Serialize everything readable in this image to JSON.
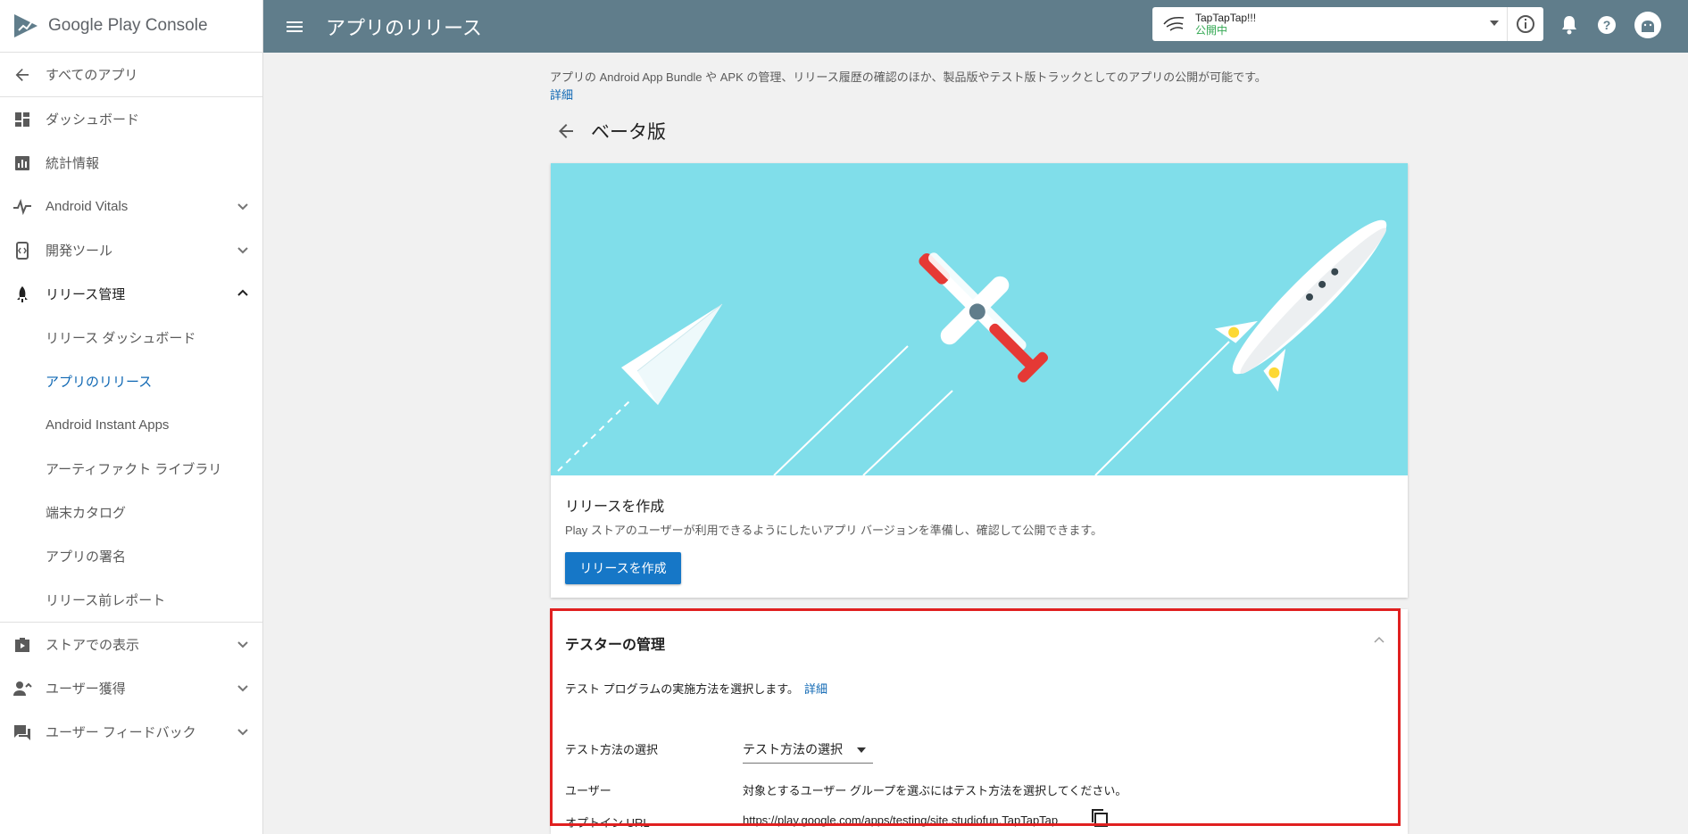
{
  "brand": {
    "name_google": "Google",
    "name_console": "Play Console"
  },
  "sidebar": {
    "back_label": "すべてのアプリ",
    "items": [
      {
        "label": "ダッシュボード",
        "icon": "dashboard-icon"
      },
      {
        "label": "統計情報",
        "icon": "stats-icon"
      },
      {
        "label": "Android Vitals",
        "icon": "vitals-icon"
      },
      {
        "label": "開発ツール",
        "icon": "dev-tools-icon"
      },
      {
        "label": "リリース管理",
        "icon": "rocket-icon"
      }
    ],
    "sub_items": [
      {
        "label": "リリース ダッシュボード"
      },
      {
        "label": "アプリのリリース"
      },
      {
        "label": "Android Instant Apps"
      },
      {
        "label": "アーティファクト ライブラリ"
      },
      {
        "label": "端末カタログ"
      },
      {
        "label": "アプリの署名"
      },
      {
        "label": "リリース前レポート"
      }
    ],
    "bottom_items": [
      {
        "label": "ストアでの表示",
        "icon": "store-icon"
      },
      {
        "label": "ユーザー獲得",
        "icon": "user-add-icon"
      },
      {
        "label": "ユーザー フィードバック",
        "icon": "feedback-icon"
      }
    ]
  },
  "topbar": {
    "title": "アプリのリリース",
    "app_name": "TapTapTap!!!",
    "app_status": "公開中"
  },
  "main": {
    "intro": "アプリの Android App Bundle や APK の管理、リリース履歴の確認のほか、製品版やテスト版トラックとしてのアプリの公開が可能です。",
    "intro_link": "詳細",
    "track_title": "ベータ版",
    "release_card": {
      "title": "リリースを作成",
      "description": "Play ストアのユーザーが利用できるようにしたいアプリ バージョンを準備し、確認して公開できます。",
      "button": "リリースを作成"
    },
    "testers": {
      "title": "テスターの管理",
      "description": "テスト プログラムの実施方法を選択します。",
      "link": "詳細",
      "method_label": "テスト方法の選択",
      "method_value": "テスト方法の選択",
      "users_label": "ユーザー",
      "users_value": "対象とするユーザー グループを選ぶにはテスト方法を選択してください。",
      "optin_label": "オプトイン URL",
      "optin_value": "https://play.google.com/apps/testing/site.studiofun.TapTapTap"
    }
  }
}
